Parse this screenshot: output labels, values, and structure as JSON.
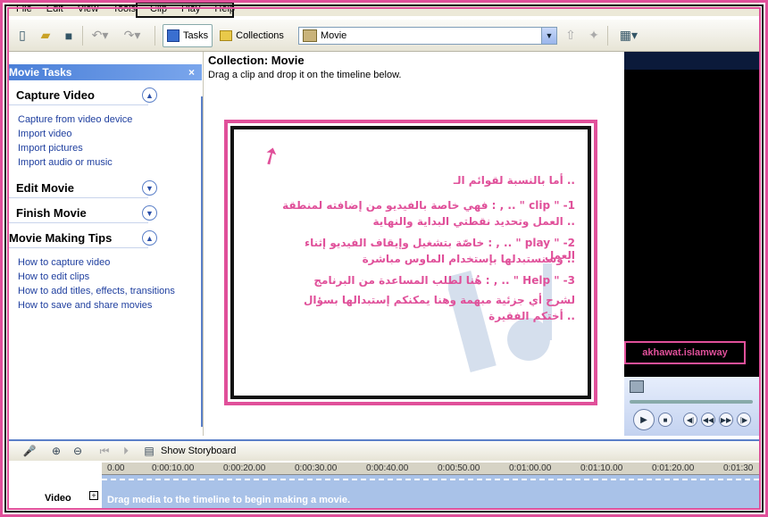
{
  "menu": {
    "items": [
      "File",
      "Edit",
      "View",
      "Tools",
      "Clip",
      "Play",
      "Help"
    ]
  },
  "toolbar": {
    "tasks_label": "Tasks",
    "collections_label": "Collections",
    "collection_value": "Movie"
  },
  "tasks_panel": {
    "title": "Movie Tasks",
    "close": "×",
    "sections": [
      {
        "title": "Capture Video",
        "expanded": true,
        "links": [
          "Capture from video device",
          "Import video",
          "Import pictures",
          "Import audio or music"
        ]
      },
      {
        "title": "Edit Movie",
        "expanded": false,
        "links": []
      },
      {
        "title": "Finish Movie",
        "expanded": false,
        "links": []
      },
      {
        "title": "Movie Making Tips",
        "expanded": true,
        "links": [
          "How to capture video",
          "How to edit clips",
          "How to add titles, effects, transitions",
          "How to save and share movies"
        ]
      }
    ]
  },
  "collection": {
    "title": "Collection: Movie",
    "subtitle": "Drag a clip and drop it on the timeline below."
  },
  "note": {
    "lines": [
      ".. أما بالنسبة لقوائم الـ",
      "1- \" clip \" .. , : فهي خاصة بالفيديو من إضافته لمنطقة",
      ".. العمل وتحديد نقطتي البداية والنهاية",
      "2- \" play \" .. , : خاصّة بتشغيل وإيقاف الفيديو إثناء العمل",
      ".. وسنستبدلها بإستخدام الماوس مباشرة",
      "3- \" Help \" .. , : هُنا لطلب المساعدة من البرنامج",
      "لشرح أي جزئية مبهمة وهنا يمكنكم إستبدالها بسؤال",
      ".. أختكم الفقيرة"
    ]
  },
  "preview": {
    "signature": "akhawat.islamway"
  },
  "storyboard": {
    "show_label": "Show Storyboard"
  },
  "timeline": {
    "track_label": "Video",
    "ticks": [
      "0.00",
      "0:00:10.00",
      "0:00:20.00",
      "0:00:30.00",
      "0:00:40.00",
      "0:00:50.00",
      "0:01:00.00",
      "0:01:10.00",
      "0:01:20.00",
      "0:01:30"
    ],
    "message": "Drag media to the timeline to begin making a movie."
  },
  "colors": {
    "accent_pink": "#e0509a",
    "link_blue": "#1f3f9f",
    "xp_blue": "#4a7fd8"
  }
}
